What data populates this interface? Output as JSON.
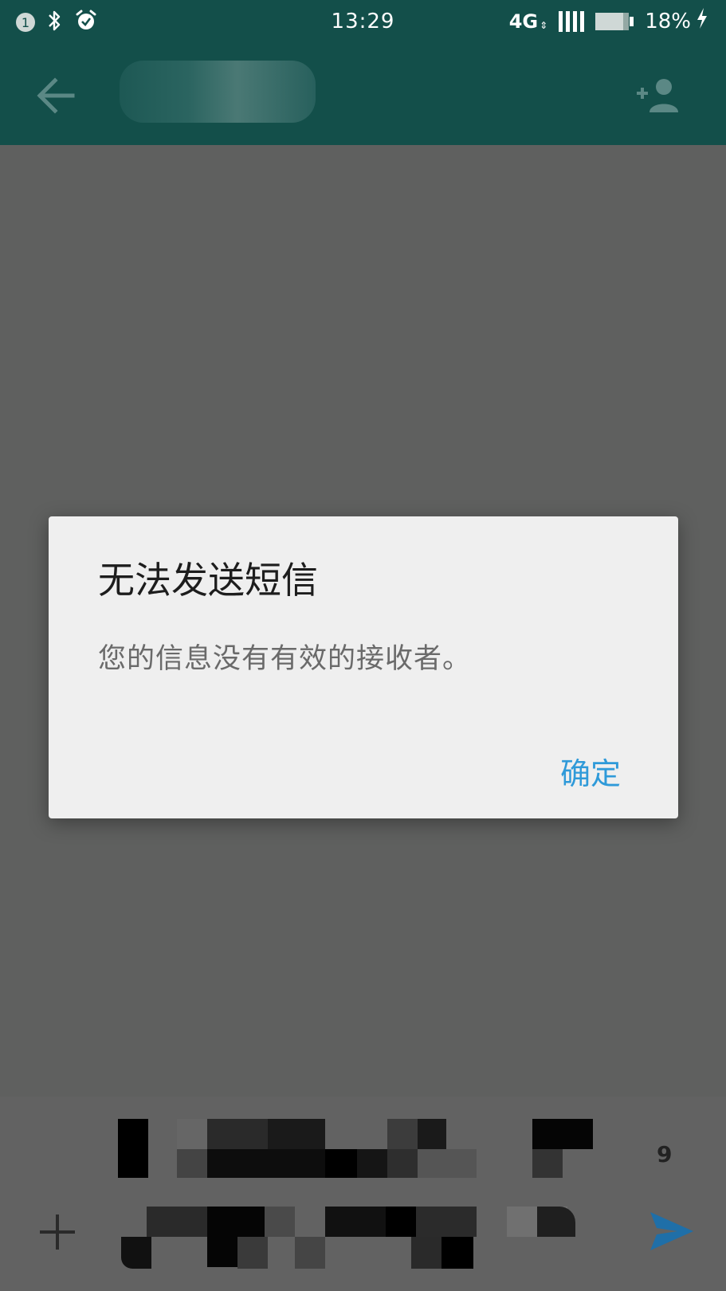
{
  "status_bar": {
    "sim_slot": "1",
    "time": "13:29",
    "network": "4G",
    "battery_percent": "18%",
    "battery_level": 0.82,
    "icons": [
      "sim-indicator",
      "bluetooth-icon",
      "alarm-icon",
      "signal-icon",
      "battery-icon",
      "charging-icon"
    ]
  },
  "app_bar": {
    "icons": [
      "back-arrow-icon",
      "add-contact-icon"
    ]
  },
  "dialog": {
    "title": "无法发送短信",
    "message": "您的信息没有有效的接收者。",
    "ok_label": "确定"
  },
  "compose": {
    "char_counter": "9",
    "icons": [
      "plus-icon",
      "send-icon"
    ]
  },
  "colors": {
    "app_bar": "#134f4a",
    "scrim": "#5f605f",
    "dialog_bg": "#efefef",
    "accent": "#2f9ad9",
    "send": "#1f6fa8"
  }
}
